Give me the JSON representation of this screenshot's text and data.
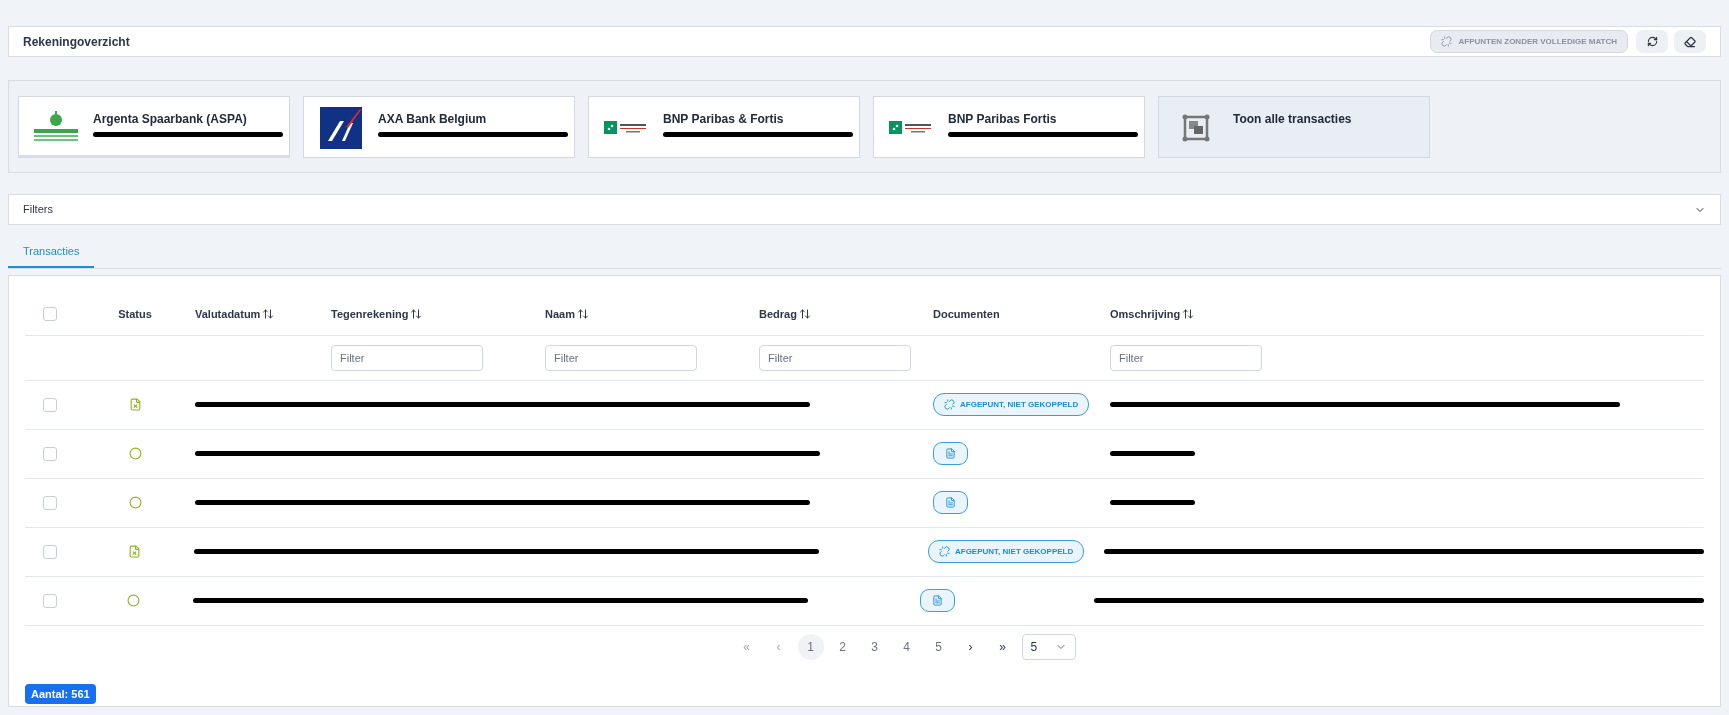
{
  "header": {
    "title": "Rekeningoverzicht",
    "match_button": {
      "label": "AFPUNTEN ZONDER VOLLEDIGE MATCH",
      "disabled": true
    }
  },
  "accounts": [
    {
      "kind": "argenta",
      "name": "Argenta Spaarbank (ASPA)",
      "selected": true,
      "redacted": true
    },
    {
      "kind": "axa",
      "name": "AXA Bank Belgium",
      "selected": false,
      "redacted": true
    },
    {
      "kind": "bnp",
      "name": "BNP Paribas & Fortis",
      "selected": false,
      "redacted": true
    },
    {
      "kind": "bnp",
      "name": "BNP Paribas Fortis",
      "selected": false,
      "redacted": true
    },
    {
      "kind": "all",
      "name": "Toon alle transacties",
      "selected": false,
      "redacted": false
    }
  ],
  "filters": {
    "label": "Filters",
    "expanded": false
  },
  "tabs": [
    {
      "label": "Transacties",
      "selected": true
    }
  ],
  "table": {
    "select_all": {
      "checked": false
    },
    "columns": [
      {
        "label": "Status",
        "sortable": false
      },
      {
        "label": "Valutadatum",
        "sortable": true
      },
      {
        "label": "Tegenrekening",
        "sortable": true,
        "filter_placeholder": "Filter"
      },
      {
        "label": "Naam",
        "sortable": true,
        "filter_placeholder": "Filter"
      },
      {
        "label": "Bedrag",
        "sortable": true,
        "filter_placeholder": "Filter"
      },
      {
        "label": "Documenten",
        "sortable": false
      },
      {
        "label": "Omschrijving",
        "sortable": true,
        "filter_placeholder": "Filter"
      }
    ],
    "rows": [
      {
        "checked": false,
        "status": {
          "kind": "unlinked"
        },
        "documents": {
          "kind": "badge",
          "label": "AFGEPUNT, NIET GEKOPPELD"
        },
        "redacted": true
      },
      {
        "checked": false,
        "status": {
          "kind": "open"
        },
        "documents": {
          "kind": "file"
        },
        "redacted": true
      },
      {
        "checked": false,
        "status": {
          "kind": "open"
        },
        "documents": {
          "kind": "file"
        },
        "redacted": true
      },
      {
        "checked": false,
        "status": {
          "kind": "unlinked"
        },
        "documents": {
          "kind": "badge",
          "label": "AFGEPUNT, NIET GEKOPPELD"
        },
        "redacted": true
      },
      {
        "checked": false,
        "status": {
          "kind": "open"
        },
        "documents": {
          "kind": "file"
        },
        "redacted": true
      }
    ]
  },
  "pagination": {
    "first": "«",
    "prev": "‹",
    "pages": [
      {
        "label": "1",
        "selected": true
      },
      {
        "label": "2",
        "selected": false
      },
      {
        "label": "3",
        "selected": false
      },
      {
        "label": "4",
        "selected": false
      },
      {
        "label": "5",
        "selected": false
      }
    ],
    "next": "›",
    "last": "»",
    "page_size": "5"
  },
  "count_badge": "Aantal: 561"
}
